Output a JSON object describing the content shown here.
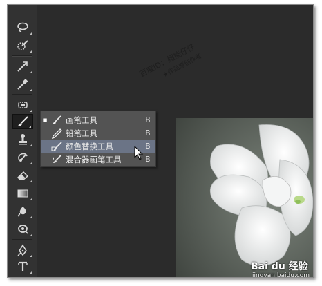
{
  "flyout": {
    "items": [
      {
        "label": "画笔工具",
        "shortcut": "B",
        "selected": true
      },
      {
        "label": "铅笔工具",
        "shortcut": "B",
        "selected": false
      },
      {
        "label": "颜色替换工具",
        "shortcut": "B",
        "selected": false
      },
      {
        "label": "混合器画笔工具",
        "shortcut": "B",
        "selected": false
      }
    ]
  },
  "toolbar": {
    "tools": [
      "lasso-icon",
      "quick-selection-icon",
      "crop-icon",
      "eyedropper-icon",
      "spot-healing-icon",
      "brush-icon",
      "clone-stamp-icon",
      "history-brush-icon",
      "eraser-icon",
      "gradient-icon",
      "blur-icon",
      "dodge-icon",
      "pen-icon",
      "type-icon"
    ]
  },
  "watermark": {
    "line1": "百度ID：超能仔仔",
    "line2": "★作品原创作者"
  },
  "brand": {
    "logo": "Bai du 经验",
    "url": "jingyan.baidu.com"
  },
  "colors": {
    "panel": "#323232",
    "workspace": "#2b2b2b",
    "flyout": "#535353",
    "hover": "#6b7486"
  }
}
